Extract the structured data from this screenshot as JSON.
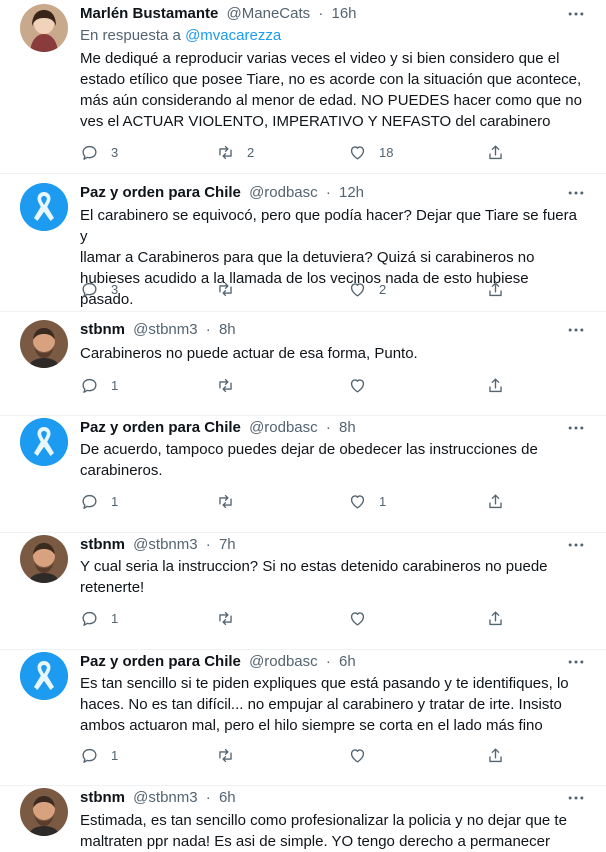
{
  "tweets": [
    {
      "name": "Marlén Bustamante",
      "handle": "@ManeCats",
      "time": "16h",
      "reply_prefix": "En respuesta a ",
      "reply_handle": "@mvacarezza",
      "text": "Me dediqué a reproducir varias veces el video y si bien considero que el\nestado etílico que posee Tiare, no es acorde con la situación que acontece,\nmás aún considerando al menor de edad. NO PUEDES hacer como que no\nves el ACTUAR VIOLENTO, IMPERATIVO Y NEFASTO del carabinero",
      "replies": "3",
      "retweets": "2",
      "likes": "18",
      "avatar": "photo-woman"
    },
    {
      "name": "Paz y orden para Chile",
      "handle": "@rodbasc",
      "time": "12h",
      "text": "El carabinero se equivocó, pero que podía hacer? Dejar que Tiare se fuera y\nllamar a Carabineros para que la detuviera? Quizá si carabineros no\nhubieses acudido a la llamada de los vecinos nada de esto hubiese pasado.",
      "replies": "3",
      "retweets": "",
      "likes": "2",
      "avatar": "ribbon-logo"
    },
    {
      "name": "stbnm",
      "handle": "@stbnm3",
      "time": "8h",
      "text": "Carabineros no puede actuar de esa forma, Punto.",
      "replies": "1",
      "retweets": "",
      "likes": "",
      "avatar": "photo-man"
    },
    {
      "name": "Paz y orden para Chile",
      "handle": "@rodbasc",
      "time": "8h",
      "text": "De acuerdo, tampoco puedes dejar de obedecer las instrucciones de\ncarabineros.",
      "replies": "1",
      "retweets": "",
      "likes": "1",
      "avatar": "ribbon-logo"
    },
    {
      "name": "stbnm",
      "handle": "@stbnm3",
      "time": "7h",
      "text": "Y cual seria la instruccion? Si no estas detenido carabineros no puede\nretenerte!",
      "replies": "1",
      "retweets": "",
      "likes": "",
      "avatar": "photo-man"
    },
    {
      "name": "Paz y orden para Chile",
      "handle": "@rodbasc",
      "time": "6h",
      "text": "Es tan sencillo si te piden expliques que está pasando y te identifiques, lo\nhaces. No es tan difícil... no empujar al carabinero y tratar de irte.  Insisto\nambos actuaron mal, pero el hilo siempre se corta en el lado más fino",
      "replies": "1",
      "retweets": "",
      "likes": "",
      "avatar": "ribbon-logo"
    },
    {
      "name": "stbnm",
      "handle": "@stbnm3",
      "time": "6h",
      "text": "Estimada, es tan sencillo como profesionalizar la policia y no dejar que te\nmaltraten ppr nada! Es asi de simple. YO tengo derecho a permanecer",
      "replies": "",
      "retweets": "",
      "likes": "",
      "avatar": "photo-man"
    }
  ],
  "separator": "·",
  "colors": {
    "text": "#0f1419",
    "muted": "#536471",
    "link": "#1d9bf0",
    "ribbon": "#5fb7dc"
  },
  "icons": [
    "reply-icon",
    "retweet-icon",
    "like-icon",
    "share-icon",
    "more-icon"
  ]
}
